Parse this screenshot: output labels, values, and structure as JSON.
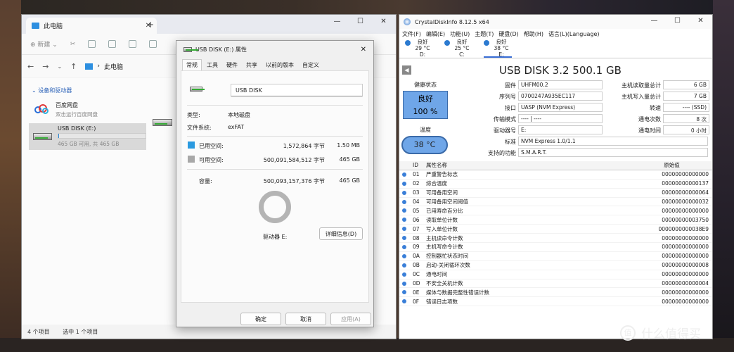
{
  "explorer": {
    "tab_title": "此电脑",
    "new_label": "新建",
    "breadcrumb": "此电脑",
    "group_label": "设备和驱动器",
    "baidu": {
      "name": "百度网盘",
      "sub": "双击运行百度网盘"
    },
    "usb": {
      "name": "USB DISK (E:)",
      "sub": "465 GB 可用, 共 465 GB",
      "used_fraction": 0.01
    },
    "status_count": "4 个项目",
    "status_selected": "选中 1 个项目"
  },
  "props": {
    "title": "USB DISK (E:) 属性",
    "tabs": [
      "常规",
      "工具",
      "硬件",
      "共享",
      "以前的版本",
      "自定义"
    ],
    "name": "USB DISK",
    "type_label": "类型:",
    "type_value": "本地磁盘",
    "fs_label": "文件系统:",
    "fs_value": "exFAT",
    "used_label": "已用空间:",
    "used_bytes": "1,572,864 字节",
    "used_size": "1.50 MB",
    "free_label": "可用空间:",
    "free_bytes": "500,091,584,512 字节",
    "free_size": "465 GB",
    "cap_label": "容量:",
    "cap_bytes": "500,093,157,376 字节",
    "cap_size": "465 GB",
    "drive_label": "驱动器 E:",
    "details_btn": "详细信息(D)",
    "ok": "确定",
    "cancel": "取消",
    "apply": "应用(A)"
  },
  "cdi": {
    "title": "CrystalDiskInfo 8.12.5 x64",
    "menu": [
      "文件(F)",
      "编辑(E)",
      "功能(U)",
      "主题(T)",
      "硬盘(D)",
      "帮助(H)",
      "语言(L)(Language)"
    ],
    "drives": [
      {
        "status": "良好",
        "temp": "29 °C",
        "letter": "D:"
      },
      {
        "status": "良好",
        "temp": "25 °C",
        "letter": "C:"
      },
      {
        "status": "良好",
        "temp": "38 °C",
        "letter": "E:"
      }
    ],
    "model": "USB DISK 3.2 500.1 GB",
    "health_label": "健康状态",
    "health_status": "良好",
    "health_pct": "100 %",
    "temp_label": "温度",
    "temp_value": "38 °C",
    "firmware_label": "固件",
    "firmware": "UHFM00.2",
    "serial_label": "序列号",
    "serial": "0700247A935EC117",
    "interface_label": "接口",
    "interface": "UASP (NVM Express)",
    "transfer_label": "传输模式",
    "transfer": "---- | ----",
    "drive_letter_label": "驱动器号",
    "drive_letter": "E:",
    "standard_label": "标准",
    "standard": "NVM Express 1.0/1.1",
    "features_label": "支持的功能",
    "features": "S.M.A.R.T.",
    "host_reads_label": "主机读取量总计",
    "host_reads": "6 GB",
    "host_writes_label": "主机写入量总计",
    "host_writes": "7 GB",
    "rotation_label": "转速",
    "rotation": "---- (SSD)",
    "power_count_label": "通电次数",
    "power_count": "8 次",
    "power_hours_label": "通电时间",
    "power_hours": "0 小时",
    "table_header": {
      "id": "ID",
      "name": "属性名称",
      "raw": "原始值"
    },
    "attrs": [
      {
        "id": "01",
        "name": "严重警告标志",
        "raw": "00000000000000"
      },
      {
        "id": "02",
        "name": "综合温度",
        "raw": "00000000000137"
      },
      {
        "id": "03",
        "name": "可用备用空间",
        "raw": "00000000000064"
      },
      {
        "id": "04",
        "name": "可用备用空间阈值",
        "raw": "00000000000032"
      },
      {
        "id": "05",
        "name": "已用寿命百分比",
        "raw": "00000000000000"
      },
      {
        "id": "06",
        "name": "读取单位计数",
        "raw": "00000000003750"
      },
      {
        "id": "07",
        "name": "写入单位计数",
        "raw": "0000000000038E9"
      },
      {
        "id": "08",
        "name": "主机读命令计数",
        "raw": "00000000000000"
      },
      {
        "id": "09",
        "name": "主机写命令计数",
        "raw": "00000000000000"
      },
      {
        "id": "0A",
        "name": "控制器忙状态时间",
        "raw": "00000000000000"
      },
      {
        "id": "0B",
        "name": "启动-关闭循环次数",
        "raw": "00000000000008"
      },
      {
        "id": "0C",
        "name": "通电时间",
        "raw": "00000000000000"
      },
      {
        "id": "0D",
        "name": "不安全关机计数",
        "raw": "00000000000004"
      },
      {
        "id": "0E",
        "name": "媒体与数据完整性错误计数",
        "raw": "00000000000000"
      },
      {
        "id": "0F",
        "name": "错误日志项数",
        "raw": "00000000000000"
      }
    ]
  },
  "watermark": {
    "glyph": "值",
    "text": "什么值得买"
  },
  "colors": {
    "used": "#2b9ae0",
    "free": "#a8a8a8",
    "health": "#6fa6e8",
    "accent": "#3a7fd8"
  }
}
